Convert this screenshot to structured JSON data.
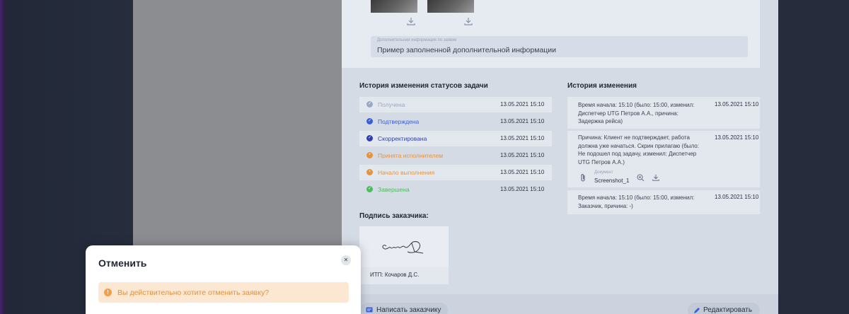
{
  "attachments": {
    "info_caption": "Дополнительная информация по заявке",
    "info_value": "Пример заполненной дополнительной информации"
  },
  "status_history": {
    "title": "История изменения статусов задачи",
    "items": [
      {
        "name": "Получена",
        "date": "13.05.2021 15:10",
        "color": "#9aa9c2",
        "icon": "check-icon"
      },
      {
        "name": "Подтверждена",
        "date": "13.05.2021 15:10",
        "color": "#3a5ed6",
        "icon": "check-icon"
      },
      {
        "name": "Скорректирована",
        "date": "13.05.2021 15:10",
        "color": "#2f3fae",
        "icon": "check-icon"
      },
      {
        "name": "Принята исполнителем",
        "date": "13.05.2021 15:10",
        "color": "#e8923a",
        "icon": "clock-icon"
      },
      {
        "name": "Начало выполнения",
        "date": "13.05.2021 15:10",
        "color": "#e8923a",
        "icon": "clock-icon"
      },
      {
        "name": "Завершена",
        "date": "13.05.2021 15:10",
        "color": "#4bbd5a",
        "icon": "check-icon"
      }
    ]
  },
  "change_history": {
    "title": "История изменения",
    "items": [
      {
        "text": "Время начала: 15:10 (было: 15:00, изменил: Диспетчер UTG Петров А.А., причина: Задержка рейса)",
        "date": "13.05.2021 15:10"
      },
      {
        "text": "Причина: Клиент не подтверждает, работа должна уже начаться. Скрин прилагаю (было: Не подошел под задачу, изменил: Диспетчер UTG Петров А.А.)",
        "date": "13.05.2021 15:10",
        "doc_caption": "Документ",
        "doc_name": "Screenshot_1"
      },
      {
        "text": "Время начала: 15:10 (было: 15:00, изменил: Заказчик, причина: -)",
        "date": "13.05.2021 15:10"
      }
    ]
  },
  "signature": {
    "title": "Подпись заказчика:",
    "signer": "ИТП: Кочаров Д.С."
  },
  "bottom_bar": {
    "write_customer": "Написать заказчику",
    "edit": "Редактировать"
  },
  "modal": {
    "title": "Отменить",
    "close_icon": "close-icon",
    "warning": "Вы действительно хотите отменить заявку?"
  }
}
